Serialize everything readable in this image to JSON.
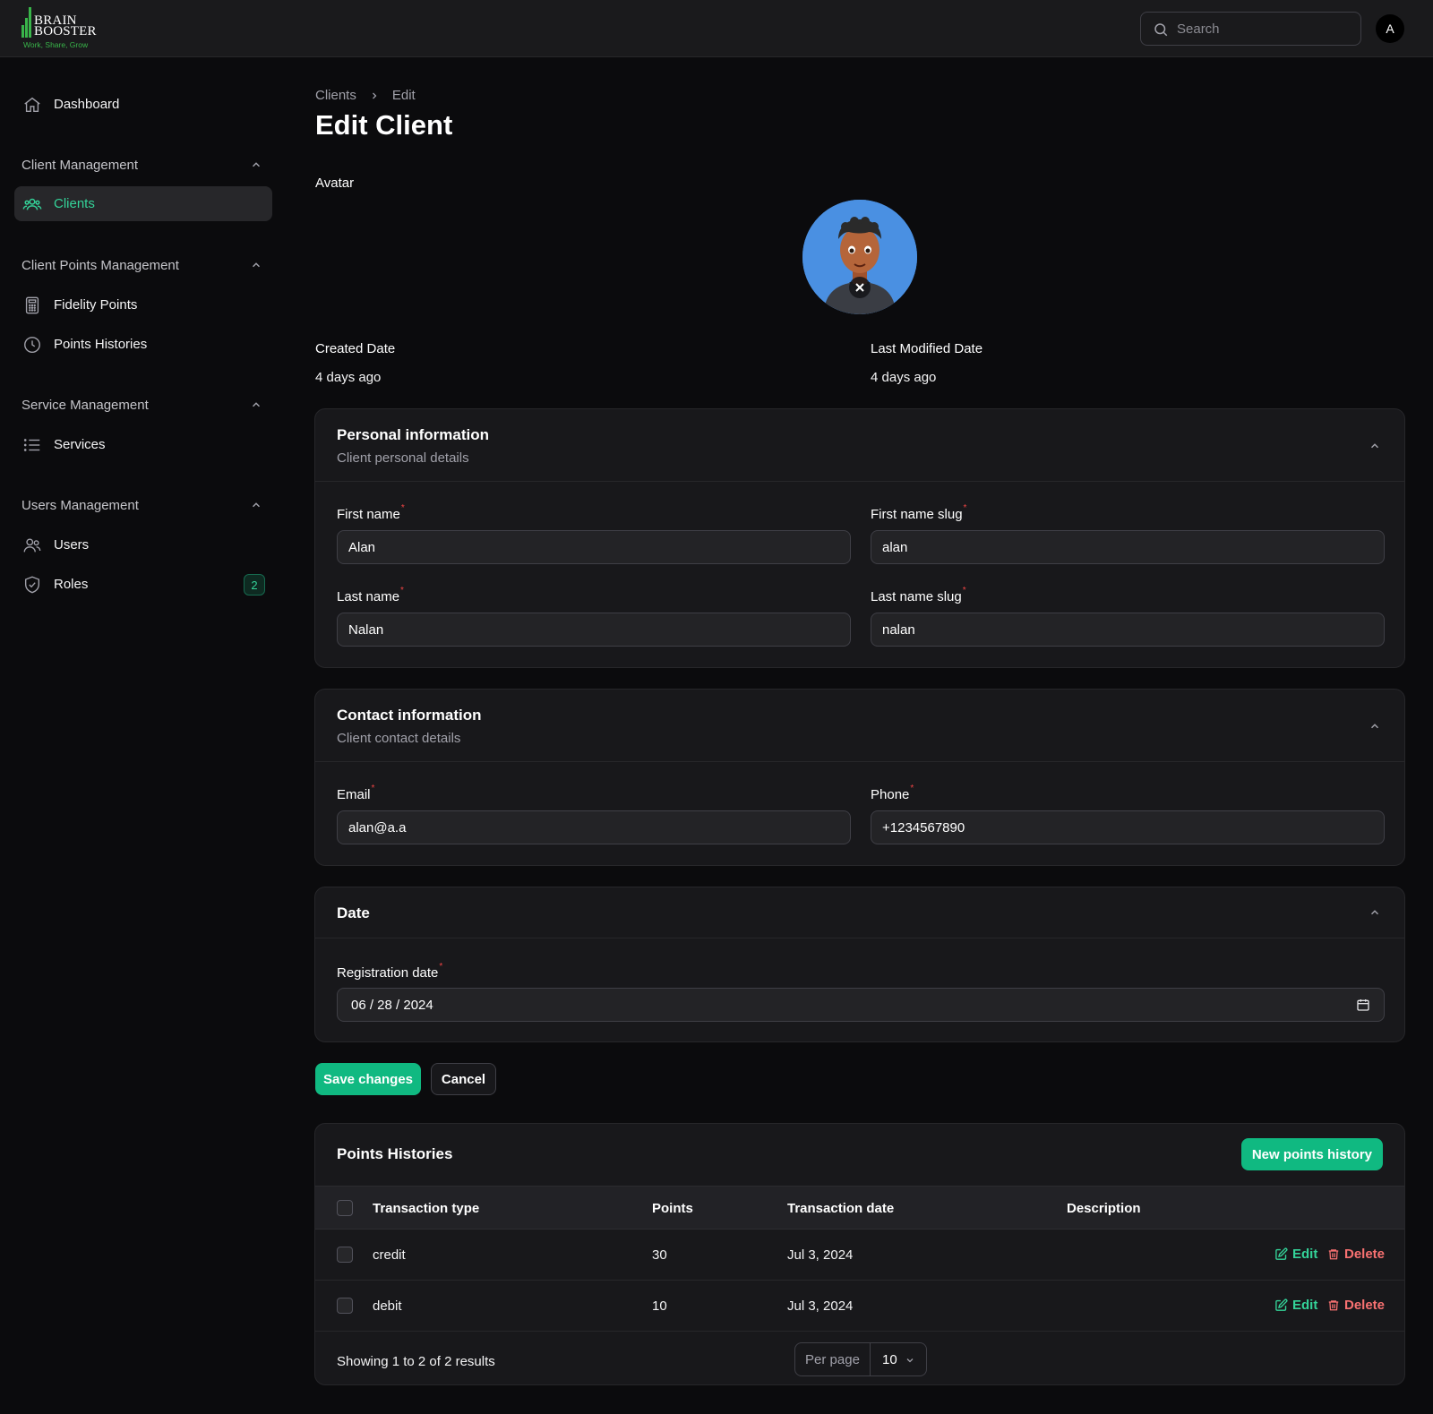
{
  "brand": {
    "line1": "BRAIN",
    "line2": "BOOSTER",
    "tagline": "Work, Share, Grow",
    "accent": "#39b54a"
  },
  "topbar": {
    "search_placeholder": "Search",
    "user_initial": "A"
  },
  "sidebar": {
    "dashboard": "Dashboard",
    "groups": [
      {
        "title": "Client Management",
        "items": [
          {
            "label": "Clients",
            "icon": "users-icon",
            "active": true
          }
        ]
      },
      {
        "title": "Client Points Management",
        "items": [
          {
            "label": "Fidelity Points",
            "icon": "calculator-icon"
          },
          {
            "label": "Points Histories",
            "icon": "clock-icon"
          }
        ]
      },
      {
        "title": "Service Management",
        "items": [
          {
            "label": "Services",
            "icon": "list-icon"
          }
        ]
      },
      {
        "title": "Users Management",
        "items": [
          {
            "label": "Users",
            "icon": "users-icon"
          },
          {
            "label": "Roles",
            "icon": "shield-check-icon",
            "badge": "2"
          }
        ]
      }
    ]
  },
  "page": {
    "breadcrumb": [
      "Clients",
      "Edit"
    ],
    "title": "Edit Client",
    "avatar_label": "Avatar",
    "created_label": "Created Date",
    "created_value": "4 days ago",
    "modified_label": "Last Modified Date",
    "modified_value": "4 days ago"
  },
  "personal": {
    "title": "Personal information",
    "subtitle": "Client personal details",
    "first_name_label": "First name",
    "first_name": "Alan",
    "first_slug_label": "First name slug",
    "first_slug": "alan",
    "last_name_label": "Last name",
    "last_name": "Nalan",
    "last_slug_label": "Last name slug",
    "last_slug": "nalan"
  },
  "contact": {
    "title": "Contact information",
    "subtitle": "Client contact details",
    "email_label": "Email",
    "email": "alan@a.a",
    "phone_label": "Phone",
    "phone": "+1234567890"
  },
  "date_section": {
    "title": "Date",
    "reg_label": "Registration date",
    "reg_value": "06 / 28 / 2024"
  },
  "actions": {
    "save": "Save changes",
    "cancel": "Cancel"
  },
  "points": {
    "title": "Points Histories",
    "new_button": "New points history",
    "columns": [
      "Transaction type",
      "Points",
      "Transaction date",
      "Description"
    ],
    "rows": [
      {
        "type": "credit",
        "points": "30",
        "date": "Jul 3, 2024",
        "description": ""
      },
      {
        "type": "debit",
        "points": "10",
        "date": "Jul 3, 2024",
        "description": ""
      }
    ],
    "edit_label": "Edit",
    "delete_label": "Delete",
    "showing": "Showing 1 to 2 of 2 results",
    "per_page_label": "Per page",
    "per_page_value": "10"
  },
  "colors": {
    "accent": "#10b981",
    "danger": "#f87171",
    "background": "#0b0b0d"
  }
}
